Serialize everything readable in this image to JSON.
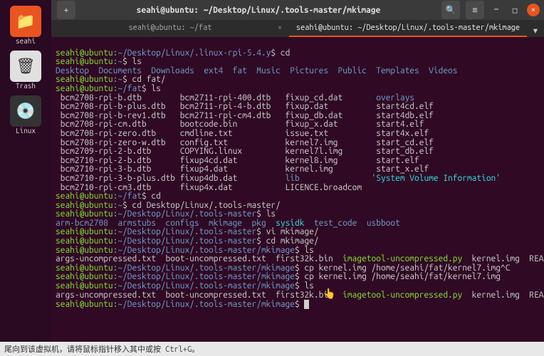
{
  "dock": {
    "seahi": "seahi",
    "trash": "Trash",
    "linux": "Linux"
  },
  "topbar": {
    "title": "seahi@ubuntu: ~/Desktop/Linux/.tools-master/mkimage",
    "plus_icon": "+"
  },
  "tabs": {
    "inactive": "seahi@ubuntu: ~/fat",
    "active": "seahi@ubuntu: ~/Desktop/Linux/.tools-master/mkimage",
    "new": "▾"
  },
  "term": {
    "l1_prompt": "seahi@ubuntu",
    "l1_path": ":~/Desktop/Linux/.linux-rpi-5.4.y",
    "l1_cmd": "$ cd",
    "l2_prompt": "seahi@ubuntu",
    "l2_path": ":~",
    "l2_cmd": "$ ls",
    "dirs": "Desktop  Documents  Downloads  ext4  fat  Music  Pictures  Public  Templates  Videos",
    "l3_prompt": "seahi@ubuntu",
    "l3_path": ":~",
    "l3_cmd": "$ cd fat/",
    "l4_prompt": "seahi@ubuntu",
    "l4_path": ":~/fat",
    "l4_cmd": "$ ls",
    "fat_r1": " bcm2708-rpi-b.dtb        bcm2711-rpi-400.dtb   fixup_cd.dat       ",
    "fat_r1d": "overlays",
    "fat_r2": " bcm2708-rpi-b-plus.dtb   bcm2711-rpi-4-b.dtb   fixup.dat          start4cd.elf",
    "fat_r3": " bcm2708-rpi-b-rev1.dtb   bcm2711-rpi-cm4.dtb   fixup_db.dat       start4db.elf",
    "fat_r4": " bcm2708-rpi-cm.dtb       bootcode.bin          fixup_x.dat        start4.elf",
    "fat_r5": " bcm2708-rpi-zero.dtb     cmdline.txt           issue.txt          start4x.elf",
    "fat_r6": " bcm2708-rpi-zero-w.dtb   config.txt            kernel7.img        start_cd.elf",
    "fat_r7": " bcm2709-rpi-2-b.dtb      COPYING.linux         kernel7l.img       start_db.elf",
    "fat_r8": " bcm2710-rpi-2-b.dtb      fixup4cd.dat          kernel8.img        start.elf",
    "fat_r9": " bcm2710-rpi-3-b.dtb      fixup4.dat            kernel.img         start_x.elf",
    "fat_r10a": " bcm2710-rpi-3-b-plus.dtb fixup4db.dat          ",
    "fat_r10b": "lib",
    "fat_r10c": "               'System Volume Information'",
    "fat_r11": " bcm2710-rpi-cm3.dtb      fixup4x.dat           LICENCE.broadcom",
    "l5_prompt": "seahi@ubuntu",
    "l5_path": ":~/fat",
    "l5_cmd": "$ cd",
    "l6_prompt": "seahi@ubuntu",
    "l6_path": ":~",
    "l6_cmd": "$ cd Desktop/Linux/.tools-master/",
    "l7_prompt": "seahi@ubuntu",
    "l7_path": ":~/Desktop/Linux/.tools-master",
    "l7_cmd": "$ ls",
    "tm_a": "arm-bcm2708  armstubs  configs  mkimage  pkg  ",
    "tm_b": "sysidk",
    "tm_c": "  test_code  usbboot",
    "l8_prompt": "seahi@ubuntu",
    "l8_path": ":~/Desktop/Linux/.tools-master",
    "l8_cmd": "$ vi mkimage/",
    "l9_prompt": "seahi@ubuntu",
    "l9_path": ":~/Desktop/Linux/.tools-master",
    "l9_cmd": "$ cd mkimage/",
    "l10_prompt": "seahi@ubuntu",
    "l10_path": ":~/Desktop/Linux/.tools-master/mkimage",
    "l10_cmd": "$ ls",
    "mk_a": "args-uncompressed.txt  boot-uncompressed.txt  first32k.bin  ",
    "mk_b": "imagetool-uncompressed.py",
    "mk_c": "  kernel.img  README",
    "l11_prompt": "seahi@ubuntu",
    "l11_path": ":~/Desktop/Linux/.tools-master/mkimage",
    "l11_cmd": "$ cp kernel.img /home/seahi/fat/kernel7.img^C",
    "l12_prompt": "seahi@ubuntu",
    "l12_path": ":~/Desktop/Linux/.tools-master/mkimage",
    "l12_cmd": "$ cp kernel.img /home/seahi/fat/kernel7.img",
    "l13_prompt": "seahi@ubuntu",
    "l13_path": ":~/Desktop/Linux/.tools-master/mkimage",
    "l13_cmd": "$ ls",
    "l14_prompt": "seahi@ubuntu",
    "l14_path": ":~/Desktop/Linux/.tools-master/mkimage",
    "l14_cmd": "$ "
  },
  "status": "尾向到该虚拟机，请将鼠标指针移入其中或按 Ctrl+G。"
}
